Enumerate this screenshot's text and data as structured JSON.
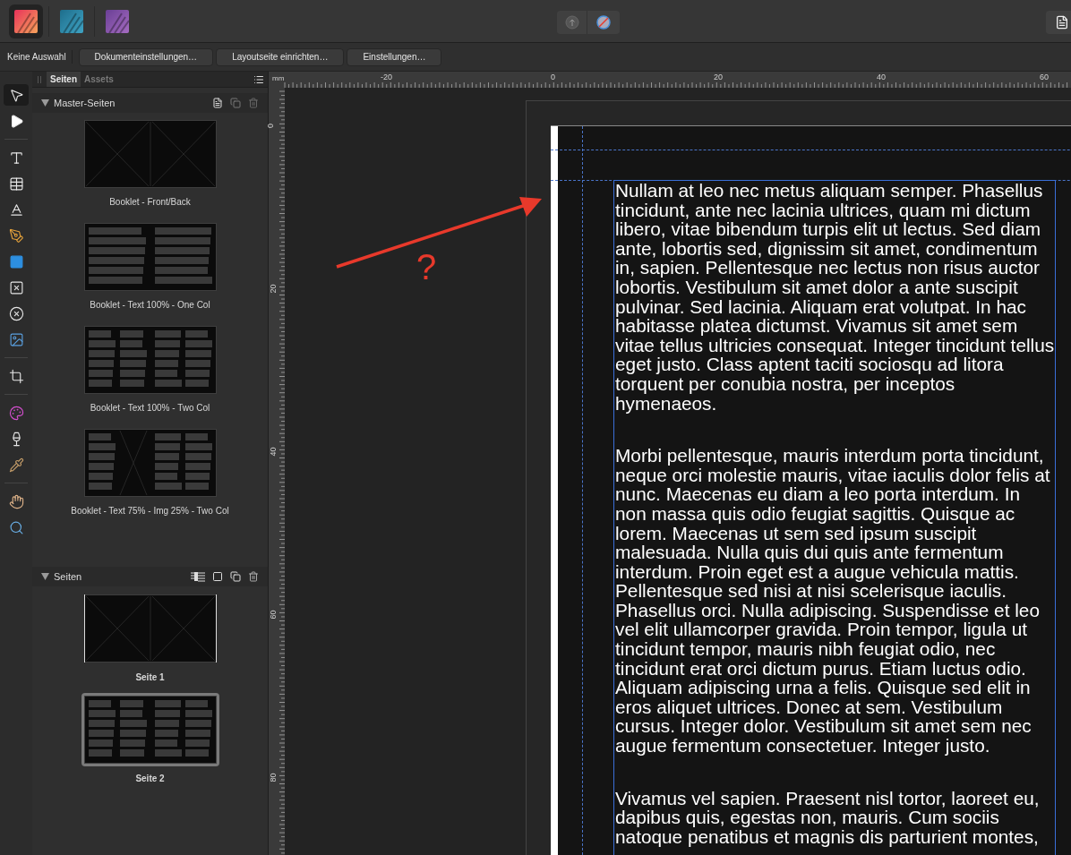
{
  "apps": [
    {
      "kind": "publisher",
      "selected": true
    },
    {
      "kind": "designer",
      "selected": false
    },
    {
      "kind": "photo",
      "selected": false
    }
  ],
  "context_bar": {
    "label": "Keine Auswahl",
    "buttons": [
      "Dokumenteinstellungen…",
      "Layoutseite einrichten…",
      "Einstellungen…"
    ]
  },
  "tools": [
    {
      "kind": "move",
      "selected": true
    },
    {
      "kind": "node",
      "selected": false
    },
    {
      "kind": "frame_text",
      "selected": false
    },
    {
      "kind": "table",
      "selected": false
    },
    {
      "kind": "artistic_text",
      "selected": false
    },
    {
      "kind": "pen",
      "selected": false
    },
    {
      "kind": "rectangle",
      "selected": false
    },
    {
      "kind": "picture_frame",
      "selected": false
    },
    {
      "kind": "ellipse_frame",
      "selected": false
    },
    {
      "kind": "place_image",
      "selected": false
    },
    {
      "kind": "crop",
      "selected": false
    },
    {
      "kind": "fill",
      "selected": false
    },
    {
      "kind": "transparency",
      "selected": false
    },
    {
      "kind": "color_picker",
      "selected": false
    },
    {
      "kind": "hand",
      "selected": false
    },
    {
      "kind": "zoom",
      "selected": false
    }
  ],
  "panel": {
    "tabs": [
      {
        "label": "Seiten",
        "selected": true
      },
      {
        "label": "Assets",
        "selected": false
      }
    ],
    "master_pages": {
      "title": "Master-Seiten",
      "expanded": true,
      "items": [
        {
          "label": "Booklet - Front/Back",
          "kind": "blank"
        },
        {
          "label": "Booklet - Text 100% - One Col",
          "kind": "onecol"
        },
        {
          "label": "Booklet - Text 100% - Two Col",
          "kind": "twocol"
        },
        {
          "label": "Booklet - Text 75% - Img 25% - Two Col",
          "kind": "imgtwocol"
        }
      ]
    },
    "pages": {
      "title": "Seiten",
      "expanded": true,
      "items": [
        {
          "label": "Seite 1",
          "kind": "blank",
          "selected": false
        },
        {
          "label": "Seite 2",
          "kind": "twocol",
          "selected": true
        }
      ]
    }
  },
  "ruler": {
    "unit": "mm",
    "x_labels": [
      "-20",
      "0",
      "20",
      "40",
      "60"
    ],
    "y_labels": [
      "0",
      "20",
      "40",
      "60",
      "80"
    ]
  },
  "document": {
    "paragraphs": [
      "Nullam at leo nec metus aliquam semper. Phasellus tincidunt, ante nec lacinia ultrices, quam mi dictum libero, vitae bibendum turpis elit ut lectus. Sed diam ante, lobortis sed, dignissim sit amet, condimentum in, sapien. Pellentesque nec lectus non risus auctor lobortis. Vestibulum sit amet dolor a ante suscipit pulvinar. Sed lacinia. Aliquam erat volutpat. In hac habitasse platea dictumst. Vivamus sit amet sem vitae tellus ultricies consequat. Integer tincidunt tellus eget justo. Class aptent taciti sociosqu ad litora torquent per conubia nostra, per inceptos hymenaeos.",
      "Morbi pellentesque, mauris interdum porta tincidunt, neque orci molestie mauris, vitae iaculis dolor felis at nunc. Maecenas eu diam a leo porta interdum. In non massa quis odio feugiat sagittis. Quisque ac lorem. Maecenas ut sem sed ipsum suscipit malesuada. Nulla quis dui quis ante fermentum interdum. Proin eget est a augue vehicula mattis. Pellentesque sed nisi at nisi scelerisque iaculis. Phasellus orci. Nulla adipiscing. Suspendisse et leo vel elit ullamcorper gravida. Proin tempor, ligula ut tincidunt tempor, mauris nibh feugiat odio, nec tincidunt erat orci dictum purus. Etiam luctus odio. Aliquam adipiscing urna a felis. Quisque sed elit in eros aliquet ultrices. Donec at sem. Vestibulum cursus. Integer dolor. Vestibulum sit amet sem nec augue fermentum consectetuer. Integer justo.",
      "Vivamus vel sapien. Praesent nisl tortor, laoreet eu, dapibus quis, egestas non, mauris. Cum sociis natoque penatibus et magnis dis parturient montes,"
    ]
  },
  "annotation": {
    "text": "?"
  }
}
